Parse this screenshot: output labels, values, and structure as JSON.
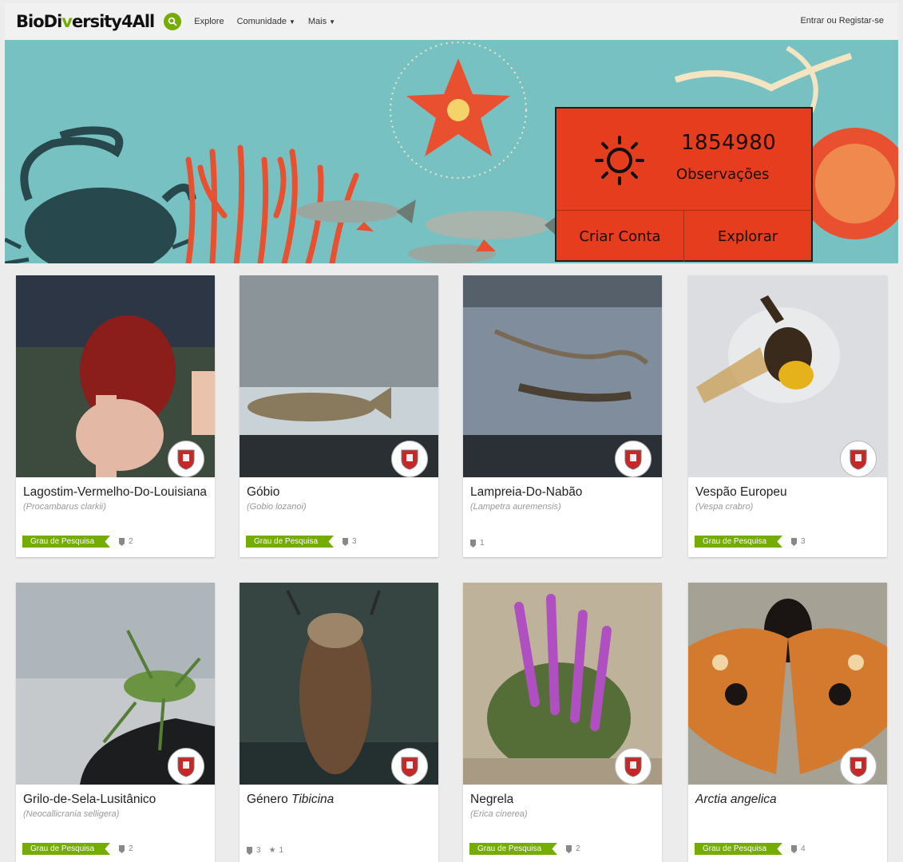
{
  "nav": {
    "logo_a": "BioDi",
    "logo_b": "v",
    "logo_c": "ersity4All",
    "links": [
      {
        "label": "Explore",
        "dropdown": false
      },
      {
        "label": "Comunidade",
        "dropdown": true
      },
      {
        "label": "Mais",
        "dropdown": true
      }
    ],
    "auth": "Entrar ou Registar-se"
  },
  "hero": {
    "count": "1854980",
    "count_label": "Observações",
    "create_label": "Criar Conta",
    "explore_label": "Explorar"
  },
  "colors": {
    "accent": "#74ac00",
    "hero_bg": "#78c1c3",
    "stat_box": "#e63d1f"
  },
  "cards": [
    {
      "name": "Lagostim-Vermelho-Do-Louisiana",
      "name_italic": "",
      "sci": "(Procambarus clarkii)",
      "grade": "Grau de Pesquisa",
      "ids": "2",
      "faves": ""
    },
    {
      "name": "Góbio",
      "name_italic": "",
      "sci": "(Gobio lozanoi)",
      "grade": "Grau de Pesquisa",
      "ids": "3",
      "faves": ""
    },
    {
      "name": "Lampreia-Do-Nabão",
      "name_italic": "",
      "sci": "(Lampetra auremensis)",
      "grade": "",
      "ids": "1",
      "faves": ""
    },
    {
      "name": "Vespão Europeu",
      "name_italic": "",
      "sci": "(Vespa crabro)",
      "grade": "Grau de Pesquisa",
      "ids": "3",
      "faves": ""
    },
    {
      "name": "Grilo-de-Sela-Lusitânico",
      "name_italic": "",
      "sci": "(Neocallicrania selligera)",
      "grade": "Grau de Pesquisa",
      "ids": "2",
      "faves": ""
    },
    {
      "name": "Género ",
      "name_italic": "Tibicina",
      "sci": "",
      "grade": "",
      "ids": "3",
      "faves": "1"
    },
    {
      "name": "Negrela",
      "name_italic": "",
      "sci": "(Erica cinerea)",
      "grade": "Grau de Pesquisa",
      "ids": "2",
      "faves": ""
    },
    {
      "name": "",
      "name_italic": "Arctia angelica",
      "sci": "",
      "grade": "Grau de Pesquisa",
      "ids": "4",
      "faves": ""
    }
  ]
}
